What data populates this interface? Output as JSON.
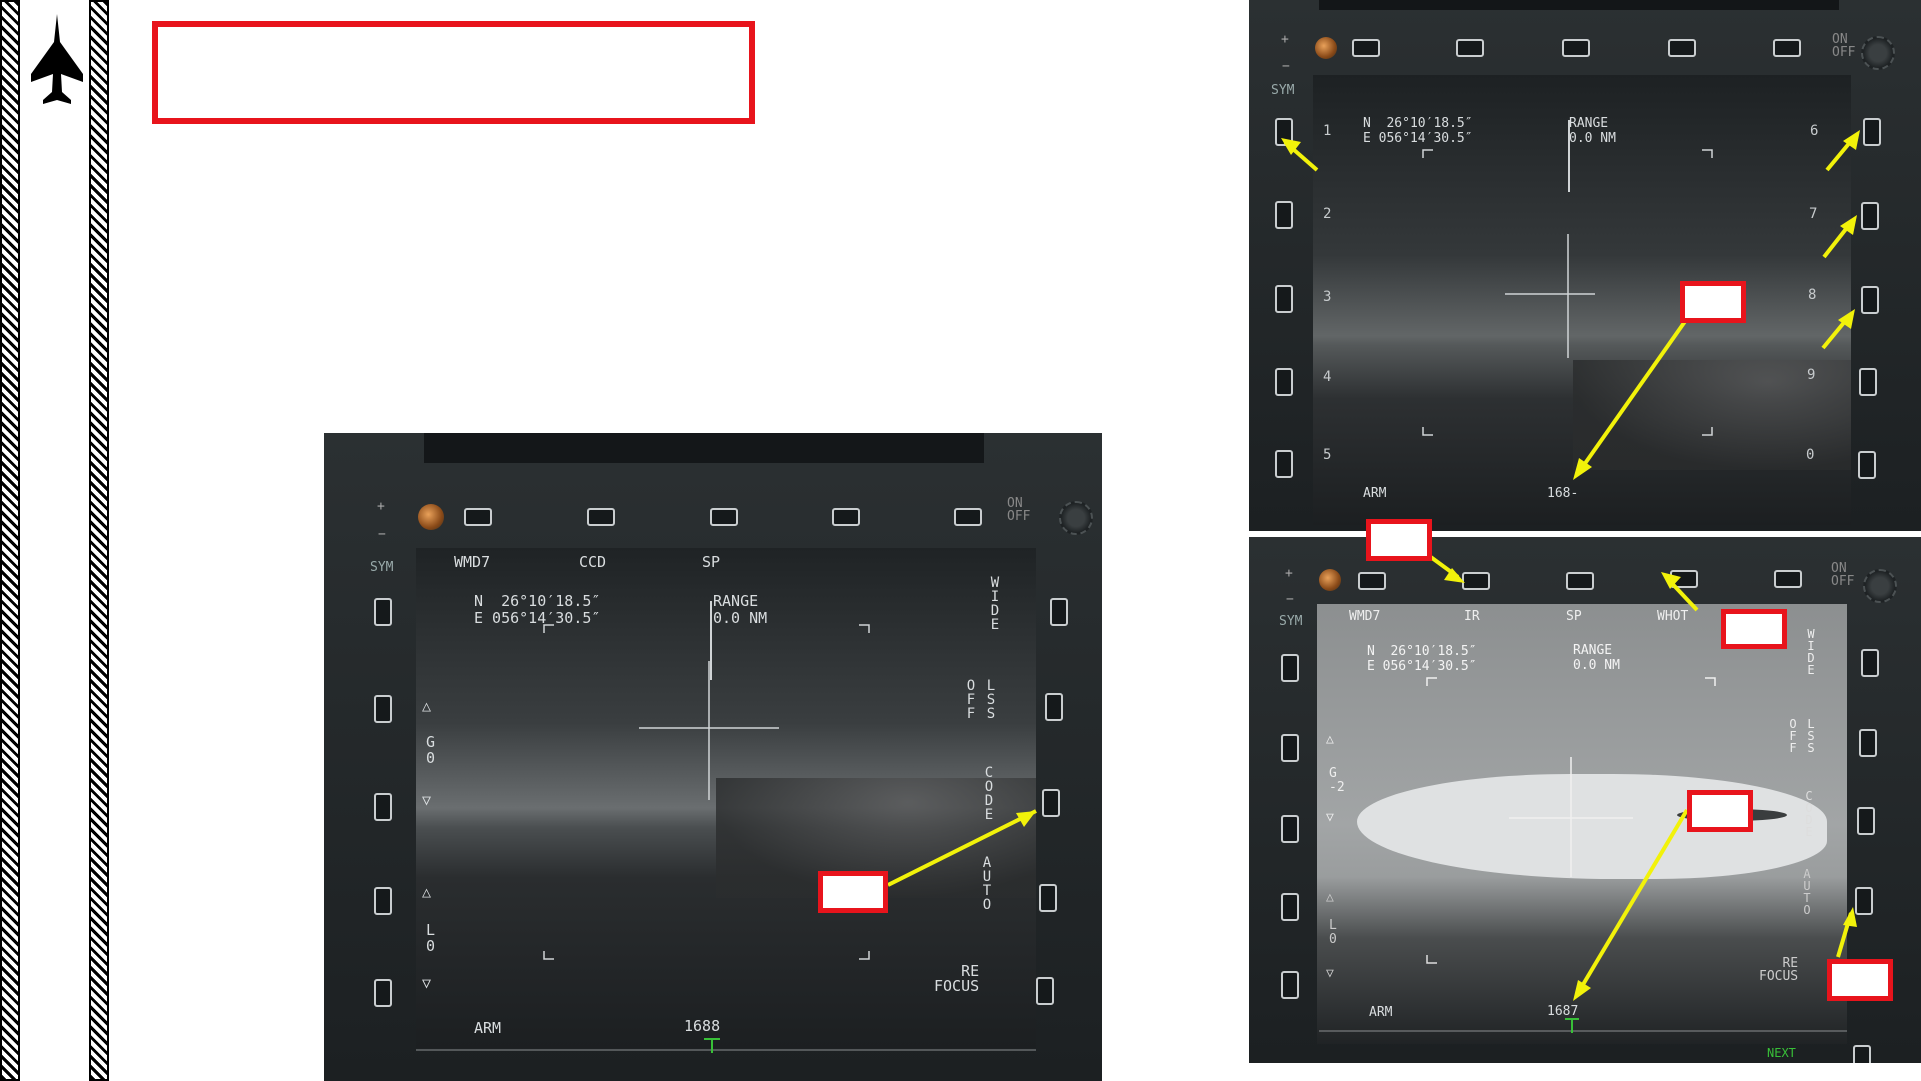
{
  "colors": {
    "callout_border": "#e8141c",
    "arrow": "#f2f20a",
    "mfd_text": "#d9dddf",
    "next_label": "#38c038"
  },
  "icons": {
    "aircraft": "fighter-jet-icon"
  },
  "main_mfd": {
    "top": {
      "sym": "SYM",
      "plus": "+",
      "minus": "−",
      "on_off": "ON\nOFF"
    },
    "labels": {
      "wmd7": "WMD7",
      "ccd": "CCD",
      "sp": "SP"
    },
    "coords": {
      "lat": "N  26°10′18.5″",
      "lon": "E 056°14′30.5″"
    },
    "range": {
      "label": "RANGE",
      "value": "0.0 NM"
    },
    "right_labels": {
      "wide": "WIDE",
      "lss_off": "LSS",
      "off": "OFF",
      "code": "CODE",
      "auto": "AUTO",
      "refocus": "RE\nFOCUS"
    },
    "left_labels": {
      "g": "G",
      "g_val": "0",
      "l": "L",
      "l_val": "0"
    },
    "bottom": {
      "arm": "ARM",
      "code": "1688"
    }
  },
  "top_right_mfd": {
    "top": {
      "sym": "SYM",
      "plus": "+",
      "minus": "−",
      "on_off": "ON\nOFF"
    },
    "left_numbers": [
      "1",
      "2",
      "3",
      "4",
      "5"
    ],
    "right_numbers": [
      "6",
      "7",
      "8",
      "9",
      "0"
    ],
    "coords": {
      "lat": "N  26°10′18.5″",
      "lon": "E 056°14′30.5″"
    },
    "range": {
      "label": "RANGE",
      "value": "0.0 NM"
    },
    "bottom": {
      "arm": "ARM",
      "code": "168-"
    }
  },
  "bottom_right_mfd": {
    "top": {
      "sym": "SYM",
      "plus": "+",
      "minus": "−",
      "on_off": "ON\nOFF"
    },
    "labels": {
      "wmd7": "WMD7",
      "ir": "IR",
      "sp": "SP",
      "whot": "WHOT"
    },
    "coords": {
      "lat": "N  26°10′18.5″",
      "lon": "E 056°14′30.5″"
    },
    "range": {
      "label": "RANGE",
      "value": "0.0 NM"
    },
    "right_labels": {
      "wide": "WIDE",
      "lss": "LSS",
      "off": "OFF",
      "code": "CODE",
      "auto": "AUTO",
      "refocus": "RE\nFOCUS"
    },
    "left_labels": {
      "g": "G",
      "g_val": "-2",
      "l": "L",
      "l_val": "0"
    },
    "bottom": {
      "arm": "ARM",
      "code": "1687",
      "next": "NEXT"
    }
  }
}
